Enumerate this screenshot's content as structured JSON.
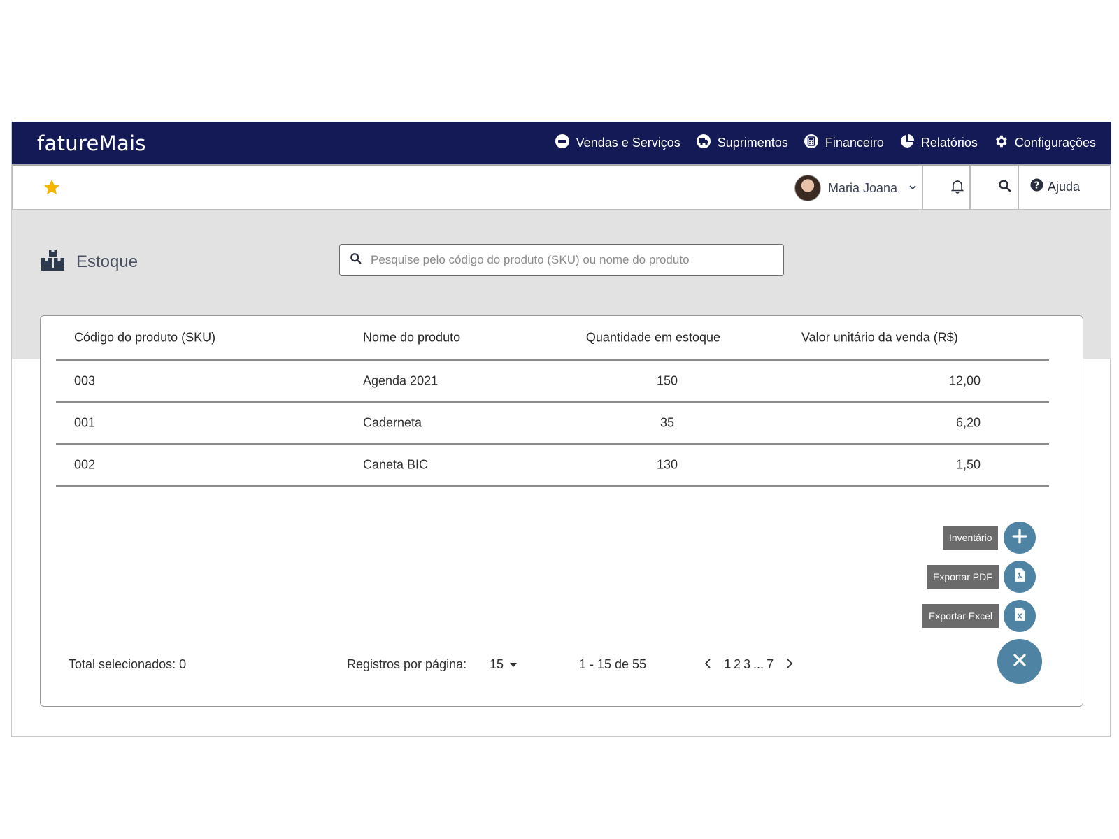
{
  "brand": {
    "logo": "fatureMais"
  },
  "nav": {
    "items": [
      {
        "label": "Vendas e Serviços",
        "icon": "minus-circle-icon"
      },
      {
        "label": "Suprimentos",
        "icon": "truck-icon"
      },
      {
        "label": "Financeiro",
        "icon": "calculator-icon"
      },
      {
        "label": "Relatórios",
        "icon": "pie-chart-icon"
      },
      {
        "label": "Configurações",
        "icon": "gear-icon"
      }
    ]
  },
  "subheader": {
    "favorite_icon": "star-icon",
    "user_name": "Maria Joana",
    "help_label": "Ajuda"
  },
  "page": {
    "title": "Estoque",
    "title_icon": "boxes-icon",
    "search_placeholder": "Pesquise pelo código do produto (SKU) ou nome do produto"
  },
  "table": {
    "headers": [
      "Código do produto (SKU)",
      "Nome do produto",
      "Quantidade em estoque",
      "Valor unitário da venda (R$)"
    ],
    "rows": [
      [
        "003",
        "Agenda 2021",
        "150",
        "12,00"
      ],
      [
        "001",
        "Caderneta",
        "35",
        "6,20"
      ],
      [
        "002",
        "Caneta BIC",
        "130",
        "1,50"
      ]
    ]
  },
  "footer": {
    "total_selected": "Total selecionados: 0",
    "per_page_label": "Registros por página:",
    "per_page_value": "15",
    "range": "1 - 15 de 55",
    "pages": [
      "1",
      "2",
      "3",
      "...",
      "7"
    ],
    "current_page": "1"
  },
  "actions": {
    "inventory": "Inventário",
    "export_pdf": "Exportar PDF",
    "export_excel": "Exportar Excel"
  },
  "colors": {
    "nav_bg": "#141a55",
    "accent": "#4e83a3",
    "band": "#e3e2e3",
    "star": "#f5b400"
  }
}
